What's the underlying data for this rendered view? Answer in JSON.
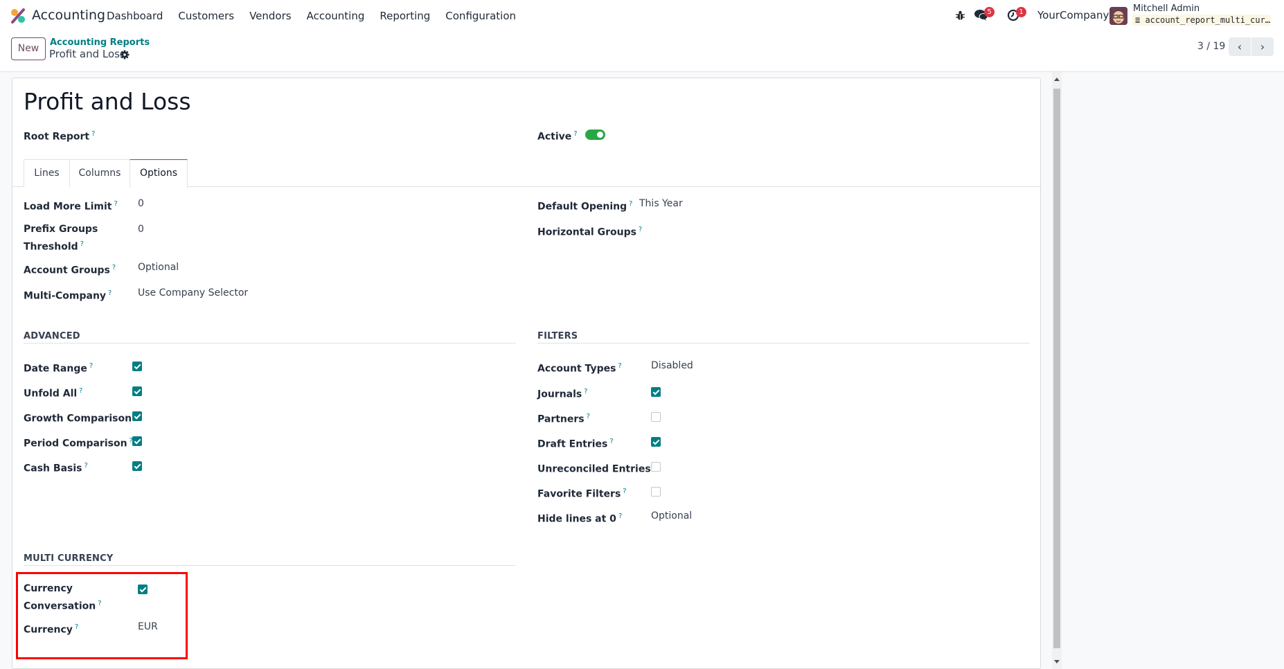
{
  "navbar": {
    "app_name": "Accounting",
    "menu": [
      "Dashboard",
      "Customers",
      "Vendors",
      "Accounting",
      "Reporting",
      "Configuration"
    ],
    "messages_badge": "5",
    "activities_badge": "1",
    "company": "YourCompany",
    "user_name": "Mitchell Admin",
    "database": "account_report_multi_cur…"
  },
  "control_panel": {
    "new_label": "New",
    "breadcrumb_parent": "Accounting Reports",
    "breadcrumb_current": "Profit and Loss",
    "pager_value": "3 / 19",
    "prev_label": "‹",
    "next_label": "›"
  },
  "form": {
    "title": "Profit and Loss",
    "root_report_label": "Root Report",
    "active_label": "Active",
    "active": true,
    "tabs": [
      "Lines",
      "Columns",
      "Options"
    ],
    "active_tab": "Options",
    "options_left": [
      {
        "label": "Load More Limit",
        "value": "0"
      },
      {
        "label": "Prefix Groups Threshold",
        "value": "0"
      },
      {
        "label": "Account Groups",
        "value": "Optional"
      },
      {
        "label": "Multi-Company",
        "value": "Use Company Selector"
      }
    ],
    "options_right": [
      {
        "label": "Default Opening",
        "value": "This Year"
      },
      {
        "label": "Horizontal Groups",
        "value": ""
      }
    ],
    "advanced": {
      "title": "ADVANCED",
      "fields": [
        {
          "label": "Date Range",
          "checked": true
        },
        {
          "label": "Unfold All",
          "checked": true
        },
        {
          "label": "Growth Comparison",
          "checked": true
        },
        {
          "label": "Period Comparison",
          "checked": true
        },
        {
          "label": "Cash Basis",
          "checked": true
        }
      ]
    },
    "filters": {
      "title": "FILTERS",
      "account_types": {
        "label": "Account Types",
        "value": "Disabled"
      },
      "fields": [
        {
          "label": "Journals",
          "checked": true
        },
        {
          "label": "Partners",
          "checked": false
        },
        {
          "label": "Draft Entries",
          "checked": true
        },
        {
          "label": "Unreconciled Entries",
          "checked": false
        },
        {
          "label": "Favorite Filters",
          "checked": false
        }
      ],
      "hide_lines": {
        "label": "Hide lines at 0",
        "value": "Optional"
      }
    },
    "multi_currency": {
      "title": "MULTI CURRENCY",
      "conversion_label": "Currency Conversation",
      "conversion_checked": true,
      "currency_label": "Currency",
      "currency_value": "EUR"
    }
  },
  "colors": {
    "brand": "#714b67",
    "accent": "#017e84",
    "toggle_on": "#28a745",
    "badge": "#dc3545",
    "highlight": "#ff0000"
  }
}
